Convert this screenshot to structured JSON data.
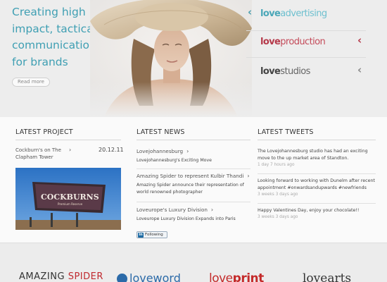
{
  "hero": {
    "headline": "Creating high impact, tactical communications for brands",
    "read_more": "Read more"
  },
  "brands": [
    {
      "prefix": "love",
      "suffix": "advertising",
      "chevron": "‹"
    },
    {
      "prefix": "love",
      "suffix": "production",
      "chevron": "‹"
    },
    {
      "prefix": "love",
      "suffix": "studios",
      "chevron": "‹"
    }
  ],
  "latest_project": {
    "heading": "LATEST PROJECT",
    "title": "Cockburn's on The Clapham Tower",
    "chevron": "›",
    "date": "20.12.11",
    "billboard_brand": "COCKBURNS",
    "billboard_tagline": "Premium Reserve"
  },
  "latest_news": {
    "heading": "LATEST NEWS",
    "items": [
      {
        "title": "Lovejohannesburg",
        "chevron": "›",
        "desc": "Lovejohannesburg's Exciting Move"
      },
      {
        "title": "Amazing Spider to represent Kulbir Thandi",
        "chevron": "›",
        "desc": "Amazing Spider announce their representation of world renowned photographer"
      },
      {
        "title": "Loveurope's Luxury Division",
        "chevron": "›",
        "desc": "Loveurope Luxury Division Expands into Paris"
      }
    ],
    "linkedin": {
      "badge": "in",
      "label": "Following"
    }
  },
  "latest_tweets": {
    "heading": "LATEST TWEETS",
    "items": [
      {
        "text": "The Lovejohannesburg studio has had an exciting move to the up market area of Standton.",
        "time": "1 day 7 hours ago"
      },
      {
        "text": "Looking forward to working with Dunelm after recent appointment #onwardsandupwards #newfriends",
        "time": "3 weeks 3 days ago"
      },
      {
        "text": "Happy Valentines Day, enjoy your chocolate!!",
        "time": "3 weeks 3 days ago"
      }
    ]
  },
  "logos": {
    "spider_a": "AMAZING ",
    "spider_b": "SPIDER",
    "word": "loveword",
    "print_a": "love",
    "print_b": "print",
    "arts": "lovearts"
  },
  "colors": {
    "accent_teal": "#3f9fb3",
    "production_red": "#b5394a",
    "spider_red": "#c0292f",
    "word_blue": "#2b6aa8"
  }
}
